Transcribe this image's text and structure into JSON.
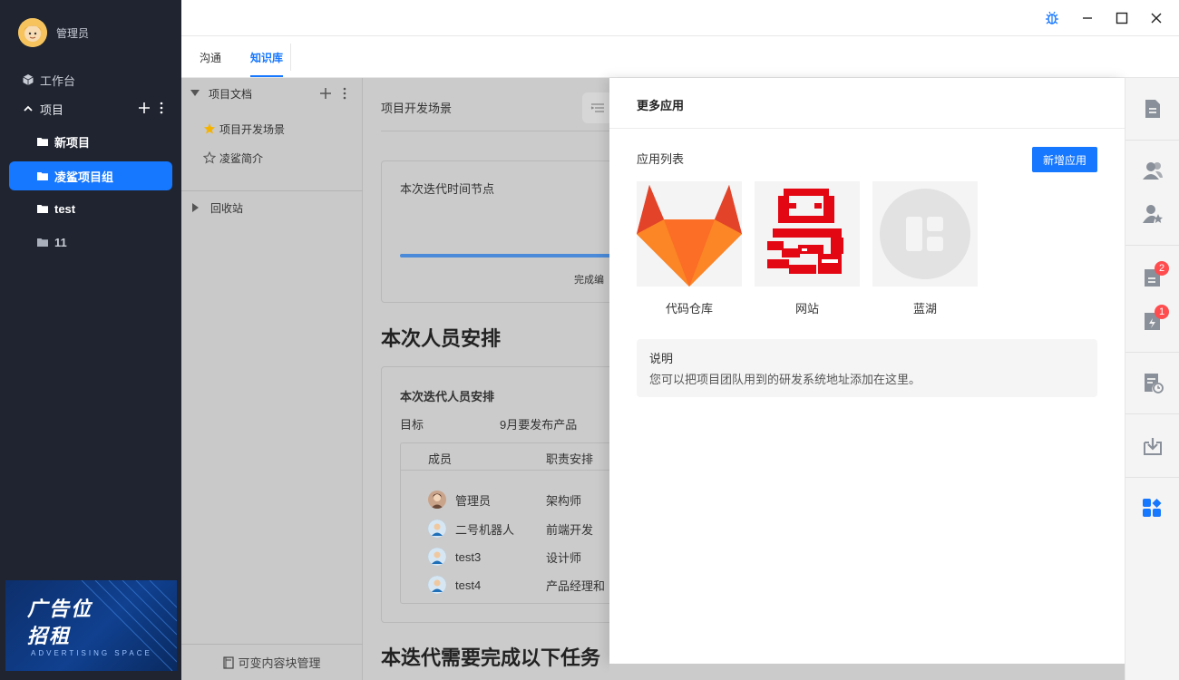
{
  "sidebar": {
    "user_name": "管理员",
    "workbench_label": "工作台",
    "projects_label": "项目",
    "projects": [
      {
        "label": "新项目"
      },
      {
        "label": "凌鲨项目组"
      },
      {
        "label": "test"
      },
      {
        "label": "11"
      }
    ],
    "ad": {
      "line1": "广告位",
      "line2": "招租",
      "sub": "ADVERTISING SPACE"
    }
  },
  "tabs": [
    {
      "label": "沟通"
    },
    {
      "label": "知识库"
    }
  ],
  "doc_tree": {
    "root_label": "项目文档",
    "items": [
      {
        "label": "项目开发场景"
      },
      {
        "label": "凌鲨简介"
      }
    ],
    "recycle_label": "回收站",
    "bottom_label": "可变内容块管理"
  },
  "main": {
    "doc_title": "项目开发场景",
    "timeline_card_title": "本次迭代时间节点",
    "timeline_caption": "完成编",
    "section1_title": "本次人员安排",
    "staff_card_title": "本次迭代人员安排",
    "goal_label": "目标",
    "goal_value": "9月要发布产品",
    "table_headers": [
      "成员",
      "职责安排"
    ],
    "members": [
      {
        "name": "管理员",
        "role": "架构师"
      },
      {
        "name": "二号机器人",
        "role": "前端开发"
      },
      {
        "name": "test3",
        "role": "设计师"
      },
      {
        "name": "test4",
        "role": "产品经理和"
      }
    ],
    "section2_title": "本迭代需要完成以下任务"
  },
  "drawer": {
    "title": "更多应用",
    "list_label": "应用列表",
    "add_button": "新增应用",
    "apps": [
      {
        "name": "代码仓库",
        "icon": "gitlab-logo"
      },
      {
        "name": "网站",
        "icon": "website-logo"
      },
      {
        "name": "蓝湖",
        "icon": "app-grid-icon"
      }
    ],
    "note_title": "说明",
    "note_text": "您可以把项目团队用到的研发系统地址添加在这里。"
  },
  "rail": {
    "badges": {
      "doc_count": "2",
      "alert_count": "1"
    }
  },
  "colors": {
    "accent": "#1677ff",
    "sidebar_bg": "#1f2430",
    "badge": "#ff4d4f"
  }
}
